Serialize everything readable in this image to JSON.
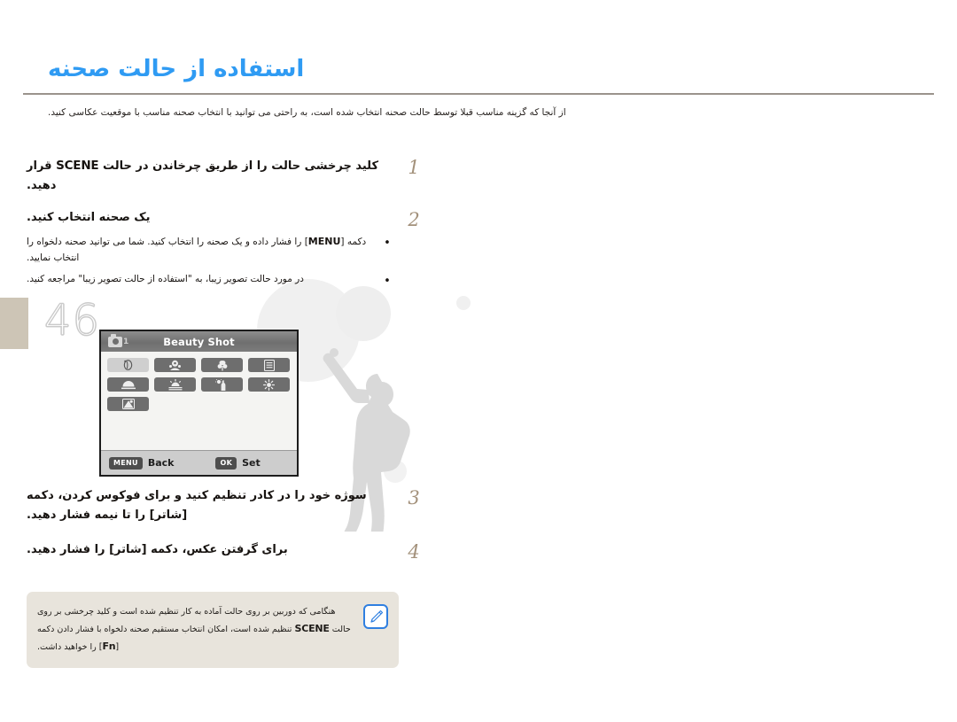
{
  "page": {
    "number": "46",
    "title": "استفاده از حالت صحنه",
    "subtitle": "از آنجا که گزینه مناسب قبلا توسط حالت صحنه انتخاب شده است، به راحتی می توانید با انتخاب صحنه مناسب با موقعیت عکاسی کنید."
  },
  "steps": [
    {
      "number": "1",
      "text_before": "کلید چرخشی حالت را از طریق چرخاندن در حالت",
      "keyword": "SCENE",
      "text_after": "قرار دهید."
    },
    {
      "number": "2",
      "text": "یک صحنه انتخاب کنید.",
      "bullets": [
        {
          "marker": "•",
          "text_before": "دکمه [",
          "keyword": "MENU",
          "text_after": "] را فشار داده و یک صحنه را انتخاب کنید. شما می توانید صحنه دلخواه را انتخاب نمایید."
        },
        {
          "marker": "•",
          "text": "در مورد حالت تصویر زیبا، به \"استفاده از حالت تصویر زیبا\" مراجعه کنید."
        }
      ]
    },
    {
      "number": "3",
      "text": "سوژه خود را در کادر تنظیم کنید و برای فوکوس کردن، دکمه [شاتر] را تا نیمه فشار دهید."
    },
    {
      "number": "4",
      "text": "برای گرفتن عکس، دکمه [شاتر] را فشار دهید."
    }
  ],
  "lcd": {
    "page_badge": "1",
    "title": "Beauty Shot",
    "rows": [
      [
        {
          "icon": "beauty-shot-icon",
          "selected": true
        },
        {
          "icon": "kids-icon",
          "selected": false
        },
        {
          "icon": "close-up-icon",
          "selected": false
        },
        {
          "icon": "text-icon",
          "selected": false
        }
      ],
      [
        {
          "icon": "sunset-icon",
          "selected": false
        },
        {
          "icon": "dawn-icon",
          "selected": false
        },
        {
          "icon": "backlight-icon",
          "selected": false
        },
        {
          "icon": "fireworks-icon",
          "selected": false
        }
      ],
      [
        {
          "icon": "beach-snow-icon",
          "selected": false
        }
      ]
    ],
    "footer": {
      "back_button": "MENU",
      "back_label": "Back",
      "ok_button": "OK",
      "ok_label": "Set"
    }
  },
  "note": {
    "icon": "note-pen-icon",
    "line1_a": "هنگامی که دوربین بر روی حالت آماده به کار تنظیم شده است و کلید چرخشی",
    "line2_a": "بر روی حالت",
    "keyword1": "SCENE",
    "line2_b": "تنظیم شده است، امکان انتخاب مستقیم صحنه دلخواه",
    "line3_a": "با فشار دادن دکمه [",
    "keyword2": "Fn",
    "line3_b": "] را خواهید داشت."
  },
  "colors": {
    "title_blue": "#2f9bf3",
    "step_number_brown": "#a3917b",
    "note_background": "#e8e4dc",
    "chapter_tab": "#cdc5b6",
    "note_icon_blue": "#2f7fe0"
  }
}
